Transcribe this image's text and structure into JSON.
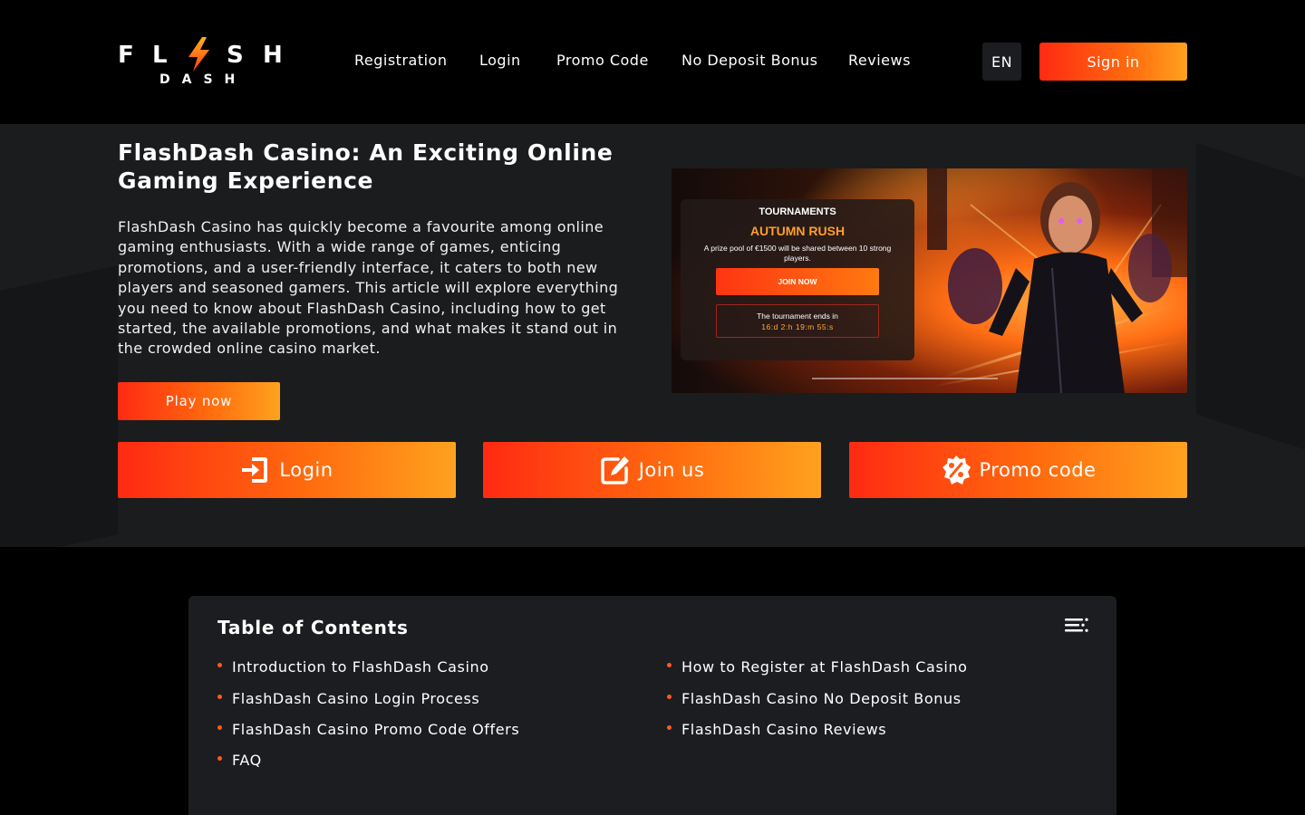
{
  "brand": {
    "logo_top_letters": [
      "F",
      "L",
      "S",
      "H"
    ],
    "logo_sub": "DASH"
  },
  "nav": {
    "items": [
      "Registration",
      "Login",
      "Promo Code",
      "No Deposit Bonus",
      "Reviews"
    ],
    "language": "EN",
    "signin_label": "Sign in"
  },
  "hero": {
    "title": "FlashDash Casino: An Exciting Online Gaming Experience",
    "text": "FlashDash Casino has quickly become a favourite among online gaming enthusiasts. With a wide range of games, enticing promotions, and a user-friendly interface, it caters to both new players and seasoned gamers. This article will explore everything you need to know about FlashDash Casino, including how to get started, the available promotions, and what makes it stand out in the crowded online casino market.",
    "play_label": "Play now"
  },
  "banner": {
    "heading": "TOURNAMENTS",
    "name": "AUTUMN RUSH",
    "description": "A prize pool of €1500 will be shared between 10 strong players.",
    "join_label": "JOIN NOW",
    "ends_label": "The tournament ends in",
    "countdown": "16:d  2:h  19:m  55:s"
  },
  "actions": {
    "login_label": "Login",
    "join_label": "Join us",
    "promo_label": "Promo code"
  },
  "toc": {
    "title": "Table of Contents",
    "left": [
      "Introduction to FlashDash Casino",
      "FlashDash Casino Login Process",
      "FlashDash Casino Promo Code Offers",
      "FAQ"
    ],
    "right": [
      "How to Register at FlashDash Casino",
      "FlashDash Casino No Deposit Bonus",
      "FlashDash Casino Reviews"
    ]
  },
  "colors": {
    "accent_start": "#ff2a12",
    "accent_end": "#ffa21e",
    "bullet": "#ff5a1f",
    "card": "#1c1d20"
  },
  "icons": [
    "bolt-icon",
    "login-icon",
    "edit-icon",
    "percent-badge-icon",
    "list-menu-icon"
  ]
}
